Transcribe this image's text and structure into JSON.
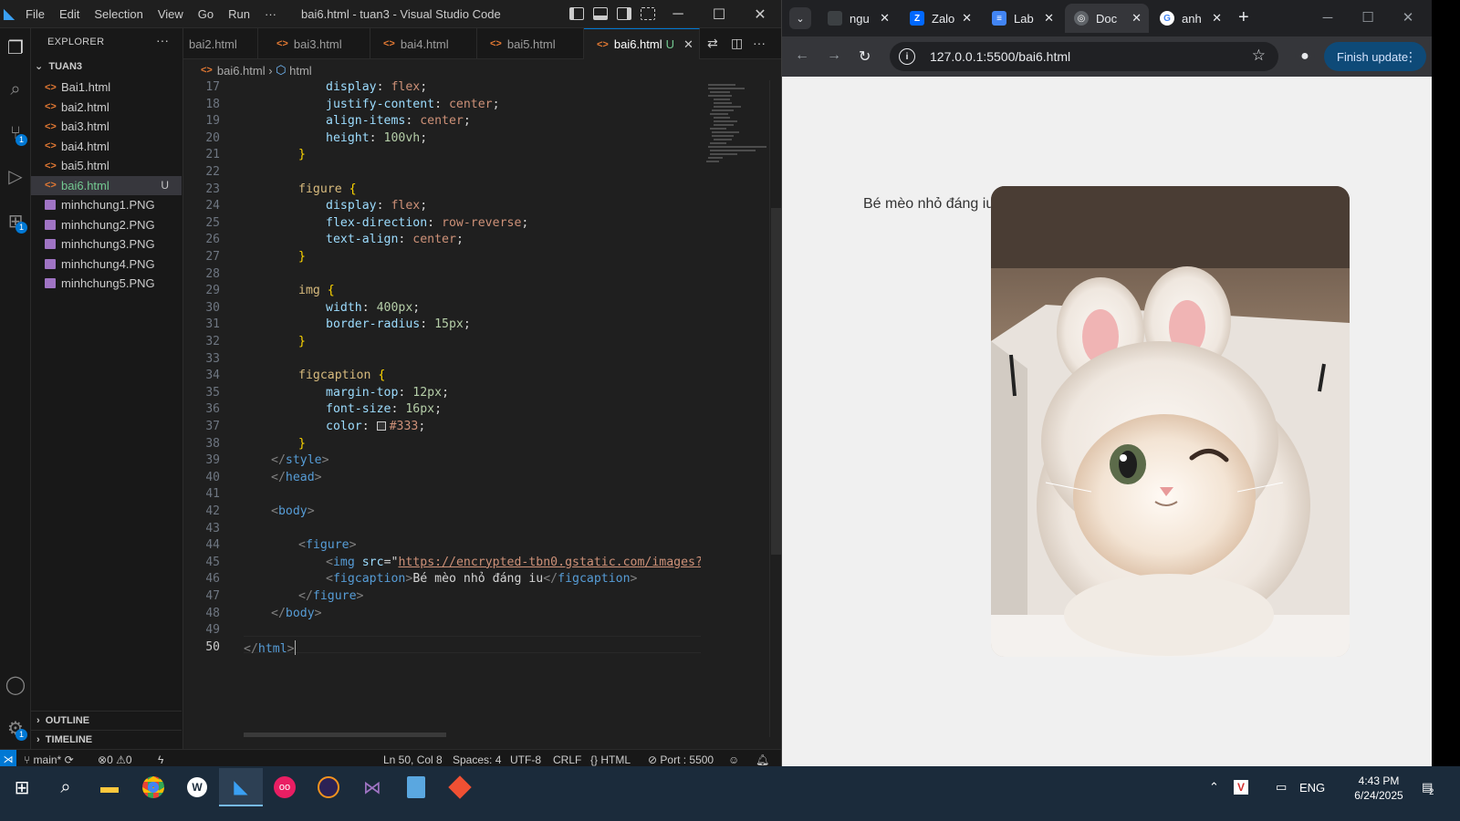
{
  "vscode": {
    "menu": [
      "File",
      "Edit",
      "Selection",
      "View",
      "Go",
      "Run",
      "···"
    ],
    "window_title": "bai6.html - tuan3 - Visual Studio Code",
    "explorer_title": "EXPLORER",
    "explorer_more": "···",
    "folder": "TUAN3",
    "files": [
      {
        "name": "Bai1.html",
        "type": "html"
      },
      {
        "name": "bai2.html",
        "type": "html"
      },
      {
        "name": "bai3.html",
        "type": "html"
      },
      {
        "name": "bai4.html",
        "type": "html"
      },
      {
        "name": "bai5.html",
        "type": "html"
      },
      {
        "name": "bai6.html",
        "type": "html",
        "status": "U",
        "active": true
      },
      {
        "name": "minhchung1.PNG",
        "type": "png"
      },
      {
        "name": "minhchung2.PNG",
        "type": "png"
      },
      {
        "name": "minhchung3.PNG",
        "type": "png"
      },
      {
        "name": "minhchung4.PNG",
        "type": "png"
      },
      {
        "name": "minhchung5.PNG",
        "type": "png"
      }
    ],
    "outline_label": "OUTLINE",
    "timeline_label": "TIMELINE",
    "tabs": [
      "bai2.html",
      "bai3.html",
      "bai4.html",
      "bai5.html",
      "bai6.html"
    ],
    "active_tab": "bai6.html",
    "active_tab_status": "U",
    "breadcrumb": [
      "bai6.html",
      "html"
    ],
    "source_control_badge": "1",
    "extensions_badge": "1",
    "accounts_badge": "1",
    "line_numbers": [
      "17",
      "18",
      "19",
      "20",
      "21",
      "22",
      "23",
      "24",
      "25",
      "26",
      "27",
      "28",
      "29",
      "30",
      "31",
      "32",
      "33",
      "34",
      "35",
      "36",
      "37",
      "38",
      "39",
      "40",
      "41",
      "42",
      "43",
      "44",
      "45",
      "46",
      "47",
      "48",
      "49",
      "50"
    ],
    "code": {
      "l17_prop": "display",
      "l17_val": "flex",
      "l18_prop": "justify-content",
      "l18_val": "center",
      "l19_prop": "align-items",
      "l19_val": "center",
      "l20_prop": "height",
      "l20_val": "100vh",
      "l23_sel": "figure",
      "l24_prop": "display",
      "l24_val": "flex",
      "l25_prop": "flex-direction",
      "l25_val": "row-reverse",
      "l26_prop": "text-align",
      "l26_val": "center",
      "l29_sel": "img",
      "l30_prop": "width",
      "l30_val": "400px",
      "l31_prop": "border-radius",
      "l31_val": "15px",
      "l34_sel": "figcaption",
      "l35_prop": "margin-top",
      "l35_val": "12px",
      "l36_prop": "font-size",
      "l36_val": "16px",
      "l37_prop": "color",
      "l37_val": "#333",
      "l39": "style",
      "l40": "head",
      "l42": "body",
      "l44": "figure",
      "l45_tag": "img",
      "l45_attr": "src",
      "l45_str": "https://encrypted-tbn0.gstatic.com/images?q=t",
      "l46_tag": "figcaption",
      "l46_text": "Bé mèo nhỏ đáng iu",
      "l47": "figure",
      "l48": "body",
      "l50": "html"
    },
    "status": {
      "branch": "main*",
      "errors": "0",
      "warnings": "0",
      "position": "Ln 50, Col 8",
      "spaces": "Spaces: 4",
      "encoding": "UTF-8",
      "eol": "CRLF",
      "language": "HTML",
      "port": "Port : 5500"
    }
  },
  "chrome": {
    "tabs": [
      {
        "title": "ngu",
        "favicon": "dim"
      },
      {
        "title": "Zalo",
        "favicon": "zalo"
      },
      {
        "title": "Lab",
        "favicon": "docs"
      },
      {
        "title": "Doc",
        "favicon": "globe",
        "active": true
      },
      {
        "title": "anh",
        "favicon": "google"
      }
    ],
    "url": "127.0.0.1:5500/bai6.html",
    "update_button": "Finish update",
    "page": {
      "caption": "Bé mèo nhỏ đáng iu",
      "image_alt": "cat wearing white bunny-ear hat"
    }
  },
  "taskbar": {
    "apps": [
      "start",
      "search",
      "file-explorer",
      "chrome",
      "app-w",
      "vscode",
      "app-oo",
      "eclipse",
      "visual-studio",
      "app-blue",
      "git"
    ],
    "tray_lang": "ENG",
    "time": "4:43 PM",
    "date": "6/24/2025",
    "notification_count": "2"
  }
}
